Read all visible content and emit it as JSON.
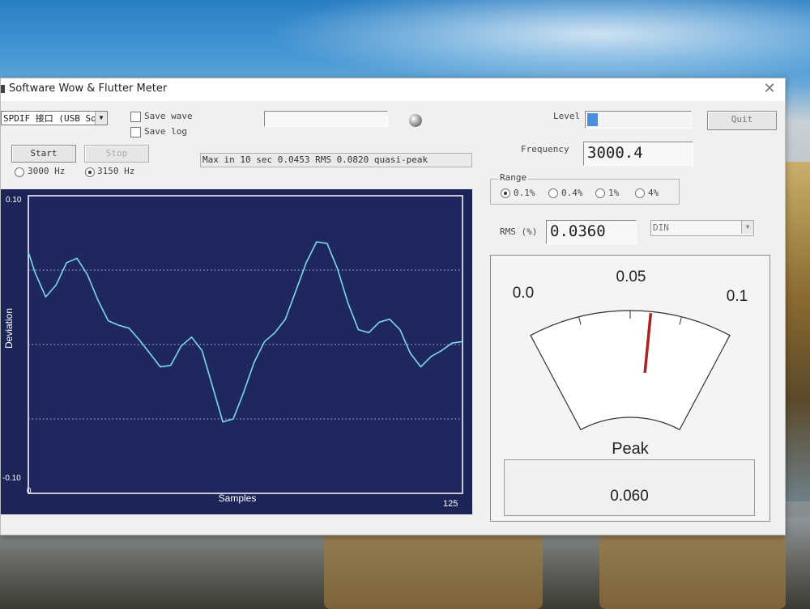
{
  "window": {
    "title": "Software Wow & Flutter Meter",
    "close_glyph": "✕"
  },
  "input": {
    "device": "SPDIF 接口 (USB Sou",
    "arrow": "▼"
  },
  "options": {
    "save_wave": "Save wave",
    "save_log": "Save log"
  },
  "buttons": {
    "start": "Start",
    "stop": "Stop",
    "quit": "Quit"
  },
  "ref_freq": {
    "opt1": "3000 Hz",
    "opt2": "3150 Hz",
    "selected": "3150 Hz"
  },
  "status_text": "Max in 10 sec 0.0453 RMS 0.0820 quasi-peak",
  "level": {
    "label": "Level",
    "fraction": 0.1
  },
  "frequency": {
    "label": "Frequency",
    "value": "3000.4"
  },
  "range": {
    "label": "Range",
    "options": [
      "0.1%",
      "0.4%",
      "1%",
      "4%"
    ],
    "selected": "0.1%"
  },
  "rms": {
    "label": "RMS (%)",
    "value": "0.0360"
  },
  "weighting": {
    "value": "DIN",
    "arrow": "▼"
  },
  "meter": {
    "label_min": "0.0",
    "label_mid": "0.05",
    "label_max": "0.1",
    "needle_value": 0.06,
    "peak_label": "Peak",
    "peak_value": "0.060",
    "needle_color": "#b02020"
  },
  "chart_data": {
    "type": "line",
    "xlabel": "Samples",
    "ylabel": "Deviation",
    "xlim": [
      0,
      125
    ],
    "ylim": [
      -0.1,
      0.1
    ],
    "x_tick_labels": [
      "0",
      "125"
    ],
    "y_tick_labels": [
      "0.10",
      "-0.10"
    ],
    "grid": "dotted",
    "series": [
      {
        "color": "#7fd8e8",
        "x": [
          0,
          2,
          5,
          8,
          11,
          14,
          17,
          20,
          23,
          26,
          29,
          32,
          35,
          38,
          41,
          44,
          47,
          50,
          53,
          56,
          59,
          62,
          65,
          68,
          71,
          74,
          77,
          80,
          83,
          86,
          89,
          92,
          95,
          98,
          101,
          104,
          107,
          110,
          113,
          116,
          119,
          122,
          125
        ],
        "y": [
          0.062,
          0.048,
          0.032,
          0.04,
          0.055,
          0.058,
          0.047,
          0.03,
          0.016,
          0.013,
          0.011,
          0.003,
          -0.006,
          -0.015,
          -0.014,
          -0.001,
          0.005,
          -0.004,
          -0.028,
          -0.052,
          -0.05,
          -0.032,
          -0.012,
          0.002,
          0.008,
          0.017,
          0.036,
          0.055,
          0.069,
          0.068,
          0.051,
          0.028,
          0.01,
          0.008,
          0.015,
          0.017,
          0.01,
          -0.006,
          -0.015,
          -0.008,
          -0.004,
          0.001,
          0.002
        ]
      }
    ]
  }
}
